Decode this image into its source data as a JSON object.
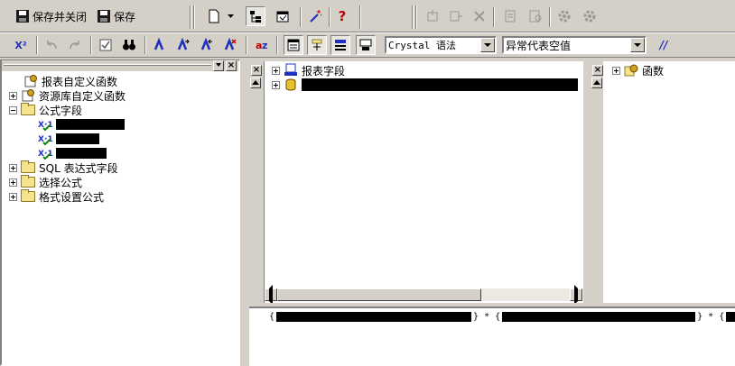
{
  "toolbar": {
    "save_close_label": "保存并关闭",
    "save_label": "保存",
    "syntax_select": "Crystal 语法",
    "null_handling_select": "异常代表空值",
    "comment_label": "//",
    "help_label": "?",
    "sort_label": "X²"
  },
  "left_tree": {
    "items": [
      {
        "label": "报表自定义函数",
        "expander": "none"
      },
      {
        "label": "资源库自定义函数",
        "expander": "plus"
      },
      {
        "label": "公式字段",
        "expander": "minus"
      },
      {
        "label": "SQL 表达式字段",
        "expander": "plus"
      },
      {
        "label": "选择公式",
        "expander": "plus"
      },
      {
        "label": "格式设置公式",
        "expander": "plus"
      }
    ],
    "formula_children": [
      "",
      "",
      ""
    ]
  },
  "fields_tree": {
    "items": [
      {
        "label": "报表字段"
      }
    ]
  },
  "functions_tree": {
    "items": [
      {
        "label": "函数"
      }
    ]
  },
  "formula": {
    "segments": [
      "{",
      "} * {",
      "} * {"
    ]
  },
  "colors": {
    "chrome": "#d4d0c8",
    "pane": "#ffffff",
    "accent_blue": "#1f2fbf",
    "help_red": "#c00000"
  }
}
